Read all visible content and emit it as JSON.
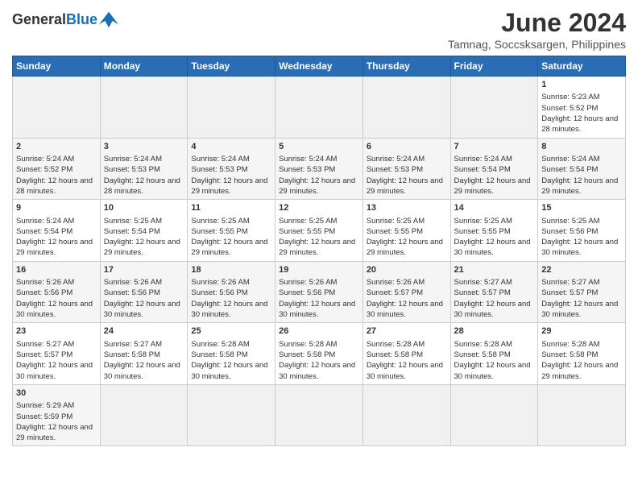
{
  "header": {
    "logo_general": "General",
    "logo_blue": "Blue",
    "month_year": "June 2024",
    "location": "Tamnag, Soccsksargen, Philippines"
  },
  "weekdays": [
    "Sunday",
    "Monday",
    "Tuesday",
    "Wednesday",
    "Thursday",
    "Friday",
    "Saturday"
  ],
  "weeks": [
    [
      {
        "day": "",
        "info": ""
      },
      {
        "day": "",
        "info": ""
      },
      {
        "day": "",
        "info": ""
      },
      {
        "day": "",
        "info": ""
      },
      {
        "day": "",
        "info": ""
      },
      {
        "day": "",
        "info": ""
      },
      {
        "day": "1",
        "info": "Sunrise: 5:23 AM\nSunset: 5:52 PM\nDaylight: 12 hours and 28 minutes."
      }
    ],
    [
      {
        "day": "2",
        "info": "Sunrise: 5:24 AM\nSunset: 5:52 PM\nDaylight: 12 hours and 28 minutes."
      },
      {
        "day": "3",
        "info": "Sunrise: 5:24 AM\nSunset: 5:53 PM\nDaylight: 12 hours and 28 minutes."
      },
      {
        "day": "4",
        "info": "Sunrise: 5:24 AM\nSunset: 5:53 PM\nDaylight: 12 hours and 29 minutes."
      },
      {
        "day": "5",
        "info": "Sunrise: 5:24 AM\nSunset: 5:53 PM\nDaylight: 12 hours and 29 minutes."
      },
      {
        "day": "6",
        "info": "Sunrise: 5:24 AM\nSunset: 5:53 PM\nDaylight: 12 hours and 29 minutes."
      },
      {
        "day": "7",
        "info": "Sunrise: 5:24 AM\nSunset: 5:54 PM\nDaylight: 12 hours and 29 minutes."
      },
      {
        "day": "8",
        "info": "Sunrise: 5:24 AM\nSunset: 5:54 PM\nDaylight: 12 hours and 29 minutes."
      }
    ],
    [
      {
        "day": "9",
        "info": "Sunrise: 5:24 AM\nSunset: 5:54 PM\nDaylight: 12 hours and 29 minutes."
      },
      {
        "day": "10",
        "info": "Sunrise: 5:25 AM\nSunset: 5:54 PM\nDaylight: 12 hours and 29 minutes."
      },
      {
        "day": "11",
        "info": "Sunrise: 5:25 AM\nSunset: 5:55 PM\nDaylight: 12 hours and 29 minutes."
      },
      {
        "day": "12",
        "info": "Sunrise: 5:25 AM\nSunset: 5:55 PM\nDaylight: 12 hours and 29 minutes."
      },
      {
        "day": "13",
        "info": "Sunrise: 5:25 AM\nSunset: 5:55 PM\nDaylight: 12 hours and 29 minutes."
      },
      {
        "day": "14",
        "info": "Sunrise: 5:25 AM\nSunset: 5:55 PM\nDaylight: 12 hours and 30 minutes."
      },
      {
        "day": "15",
        "info": "Sunrise: 5:25 AM\nSunset: 5:56 PM\nDaylight: 12 hours and 30 minutes."
      }
    ],
    [
      {
        "day": "16",
        "info": "Sunrise: 5:26 AM\nSunset: 5:56 PM\nDaylight: 12 hours and 30 minutes."
      },
      {
        "day": "17",
        "info": "Sunrise: 5:26 AM\nSunset: 5:56 PM\nDaylight: 12 hours and 30 minutes."
      },
      {
        "day": "18",
        "info": "Sunrise: 5:26 AM\nSunset: 5:56 PM\nDaylight: 12 hours and 30 minutes."
      },
      {
        "day": "19",
        "info": "Sunrise: 5:26 AM\nSunset: 5:56 PM\nDaylight: 12 hours and 30 minutes."
      },
      {
        "day": "20",
        "info": "Sunrise: 5:26 AM\nSunset: 5:57 PM\nDaylight: 12 hours and 30 minutes."
      },
      {
        "day": "21",
        "info": "Sunrise: 5:27 AM\nSunset: 5:57 PM\nDaylight: 12 hours and 30 minutes."
      },
      {
        "day": "22",
        "info": "Sunrise: 5:27 AM\nSunset: 5:57 PM\nDaylight: 12 hours and 30 minutes."
      }
    ],
    [
      {
        "day": "23",
        "info": "Sunrise: 5:27 AM\nSunset: 5:57 PM\nDaylight: 12 hours and 30 minutes."
      },
      {
        "day": "24",
        "info": "Sunrise: 5:27 AM\nSunset: 5:58 PM\nDaylight: 12 hours and 30 minutes."
      },
      {
        "day": "25",
        "info": "Sunrise: 5:28 AM\nSunset: 5:58 PM\nDaylight: 12 hours and 30 minutes."
      },
      {
        "day": "26",
        "info": "Sunrise: 5:28 AM\nSunset: 5:58 PM\nDaylight: 12 hours and 30 minutes."
      },
      {
        "day": "27",
        "info": "Sunrise: 5:28 AM\nSunset: 5:58 PM\nDaylight: 12 hours and 30 minutes."
      },
      {
        "day": "28",
        "info": "Sunrise: 5:28 AM\nSunset: 5:58 PM\nDaylight: 12 hours and 30 minutes."
      },
      {
        "day": "29",
        "info": "Sunrise: 5:28 AM\nSunset: 5:58 PM\nDaylight: 12 hours and 29 minutes."
      }
    ],
    [
      {
        "day": "30",
        "info": "Sunrise: 5:29 AM\nSunset: 5:59 PM\nDaylight: 12 hours and 29 minutes."
      },
      {
        "day": "",
        "info": ""
      },
      {
        "day": "",
        "info": ""
      },
      {
        "day": "",
        "info": ""
      },
      {
        "day": "",
        "info": ""
      },
      {
        "day": "",
        "info": ""
      },
      {
        "day": "",
        "info": ""
      }
    ]
  ]
}
